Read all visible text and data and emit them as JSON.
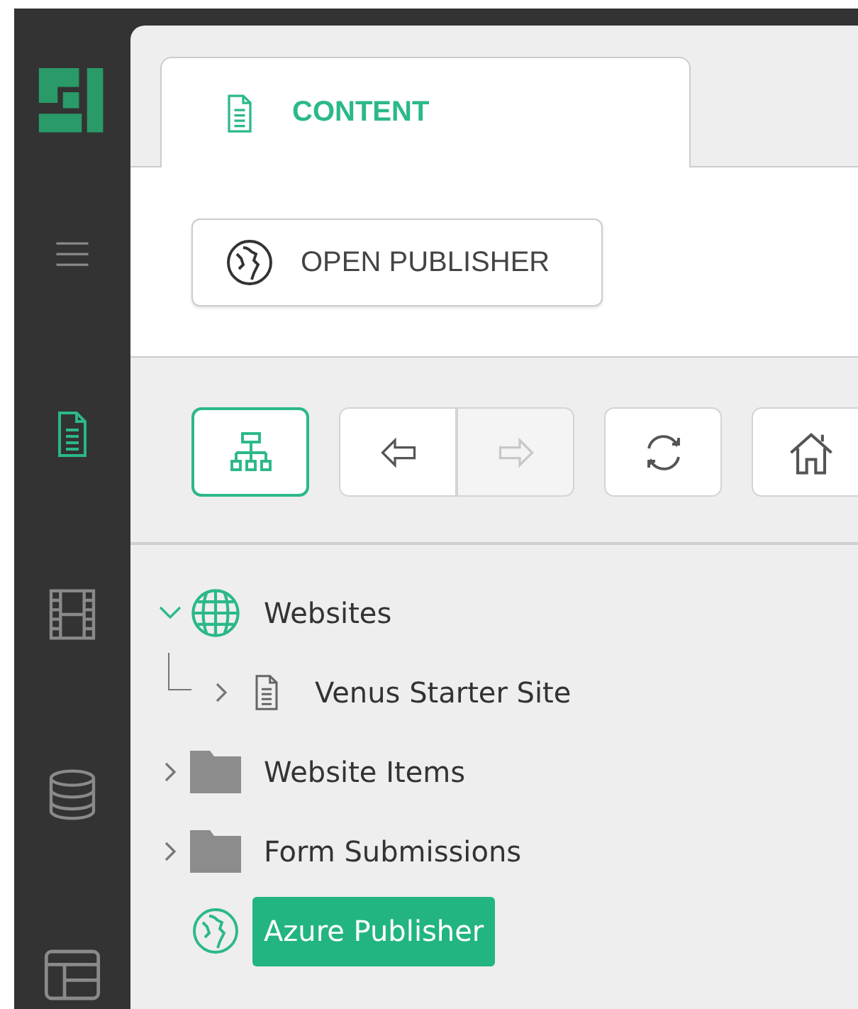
{
  "sidebar": {
    "items": [
      {
        "kind": "menu",
        "selected": false
      },
      {
        "kind": "content",
        "selected": true
      },
      {
        "kind": "media",
        "selected": false
      },
      {
        "kind": "database",
        "selected": false
      },
      {
        "kind": "layout",
        "selected": false
      }
    ]
  },
  "tabs": [
    {
      "label": "CONTENT",
      "selected": true
    }
  ],
  "actions": [
    {
      "label": "OPEN PUBLISHER"
    }
  ],
  "toolbar": [
    [
      {
        "kind": "sitemap",
        "selected": true,
        "disabled": false
      }
    ],
    [
      {
        "kind": "back",
        "selected": false,
        "disabled": false
      },
      {
        "kind": "forward",
        "selected": false,
        "disabled": true
      }
    ],
    [
      {
        "kind": "refresh",
        "selected": false,
        "disabled": false
      }
    ],
    [
      {
        "kind": "home",
        "selected": false,
        "disabled": false
      }
    ]
  ],
  "tree": [
    {
      "label": "Websites",
      "kind": "globe",
      "expandable": true,
      "expanded": true,
      "selected": false,
      "children": [
        {
          "label": "Venus Starter Site",
          "kind": "page",
          "expandable": true,
          "expanded": false,
          "selected": false
        }
      ]
    },
    {
      "label": "Website Items",
      "kind": "folder",
      "expandable": true,
      "expanded": false,
      "selected": false
    },
    {
      "label": "Form Submissions",
      "kind": "folder",
      "expandable": true,
      "expanded": false,
      "selected": false
    },
    {
      "label": "Azure Publisher",
      "kind": "publisher",
      "expandable": false,
      "expanded": false,
      "selected": true
    }
  ]
}
